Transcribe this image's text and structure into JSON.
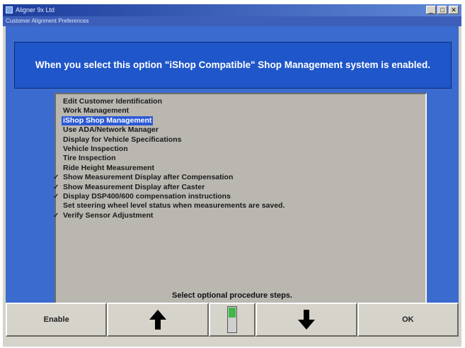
{
  "window": {
    "title": "Aligner 9x Ltd",
    "subtitle": "Customer Alignment Preferences",
    "buttons": [
      "_",
      "□",
      "✕"
    ]
  },
  "banner": {
    "text": "When you select this option \"iShop Compatible\" Shop Management system is enabled."
  },
  "list": {
    "items": [
      {
        "label": "Edit Customer Identification",
        "checked": false,
        "selected": false
      },
      {
        "label": "Work Management",
        "checked": false,
        "selected": false
      },
      {
        "label": "iShop Shop Management",
        "checked": false,
        "selected": true
      },
      {
        "label": "Use ADA/Network Manager",
        "checked": false,
        "selected": false
      },
      {
        "label": "Display for Vehicle Specifications",
        "checked": false,
        "selected": false
      },
      {
        "label": "Vehicle Inspection",
        "checked": false,
        "selected": false
      },
      {
        "label": "Tire Inspection",
        "checked": false,
        "selected": false
      },
      {
        "label": "Ride Height Measurement",
        "checked": false,
        "selected": false
      },
      {
        "label": "Show Measurement Display after Compensation",
        "checked": true,
        "selected": false
      },
      {
        "label": "Show Measurement Display after Caster",
        "checked": true,
        "selected": false
      },
      {
        "label": "Display DSP400/600 compensation instructions",
        "checked": true,
        "selected": false
      },
      {
        "label": "Set steering wheel level status when measurements are saved.",
        "checked": false,
        "selected": false
      },
      {
        "label": "Verify Sensor Adjustment",
        "checked": true,
        "selected": false
      }
    ]
  },
  "hint": "Select optional procedure steps.",
  "toolbar": {
    "enable_label": "Enable",
    "up_icon": "up-arrow-icon",
    "scroll_icon": "scroll-position-icon",
    "down_icon": "down-arrow-icon",
    "ok_label": "OK"
  },
  "colors": {
    "panel": "#3b6bcf",
    "banner": "#1f56c9",
    "selection": "#2b59d6",
    "scroll_thumb": "#3fb74a"
  }
}
